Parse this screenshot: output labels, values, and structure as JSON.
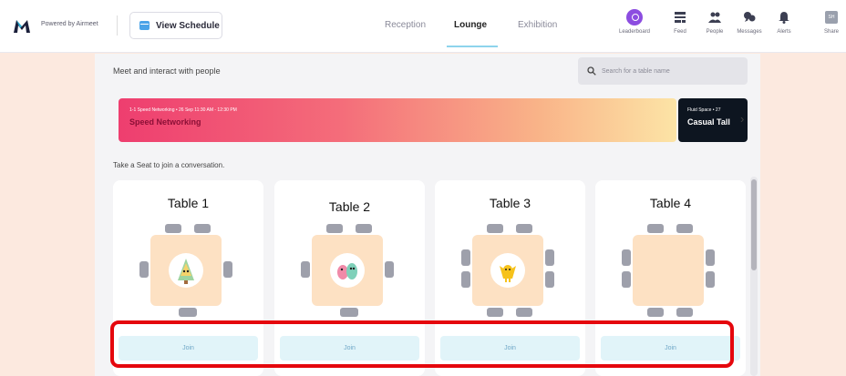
{
  "topbar": {
    "powered_by": "Powered by Airmeet",
    "schedule_label": "View Schedule",
    "tabs": [
      {
        "label": "Reception",
        "active": false
      },
      {
        "label": "Lounge",
        "active": true
      },
      {
        "label": "Exhibition",
        "active": false
      }
    ],
    "nav": [
      {
        "label": "Leaderboard",
        "icon": "trophy-icon"
      },
      {
        "label": "Feed",
        "icon": "feed-icon"
      },
      {
        "label": "People",
        "icon": "people-icon"
      },
      {
        "label": "Messages",
        "icon": "messages-icon"
      },
      {
        "label": "Alerts",
        "icon": "bell-icon"
      },
      {
        "label": "Share",
        "icon": "share-icon"
      }
    ],
    "share_badge": "SH"
  },
  "lounge": {
    "intro": "Meet and interact with people",
    "search_placeholder": "Search for a table name",
    "banner": {
      "meta": "1-1 Speed Networking • 26 Sep 11:30 AM - 12:30 PM",
      "title": "Speed Networking"
    },
    "banner2": {
      "meta": "Fluid Space • 27",
      "title": "Casual Tall"
    },
    "take_seat": "Take a Seat to join a conversation.",
    "tables": [
      {
        "name": "Table 1",
        "join": "Join",
        "avatar": "tree-avatar-icon",
        "seats": 6
      },
      {
        "name": "Table 2",
        "join": "Join",
        "avatar": "monsters-avatar-icon",
        "seats": 6
      },
      {
        "name": "Table 3",
        "join": "Join",
        "avatar": "yellow-character-avatar-icon",
        "seats": 8
      },
      {
        "name": "Table 4",
        "join": "Join",
        "avatar": "",
        "seats": 8
      }
    ]
  },
  "colors": {
    "highlight": "#e5070d",
    "banner_start": "#ee3e6f",
    "banner_end": "#fce4a6",
    "table_fill": "#fde1c3",
    "join_bg": "#e1f4f9",
    "leaderboard_purple": "#8c4de0"
  }
}
